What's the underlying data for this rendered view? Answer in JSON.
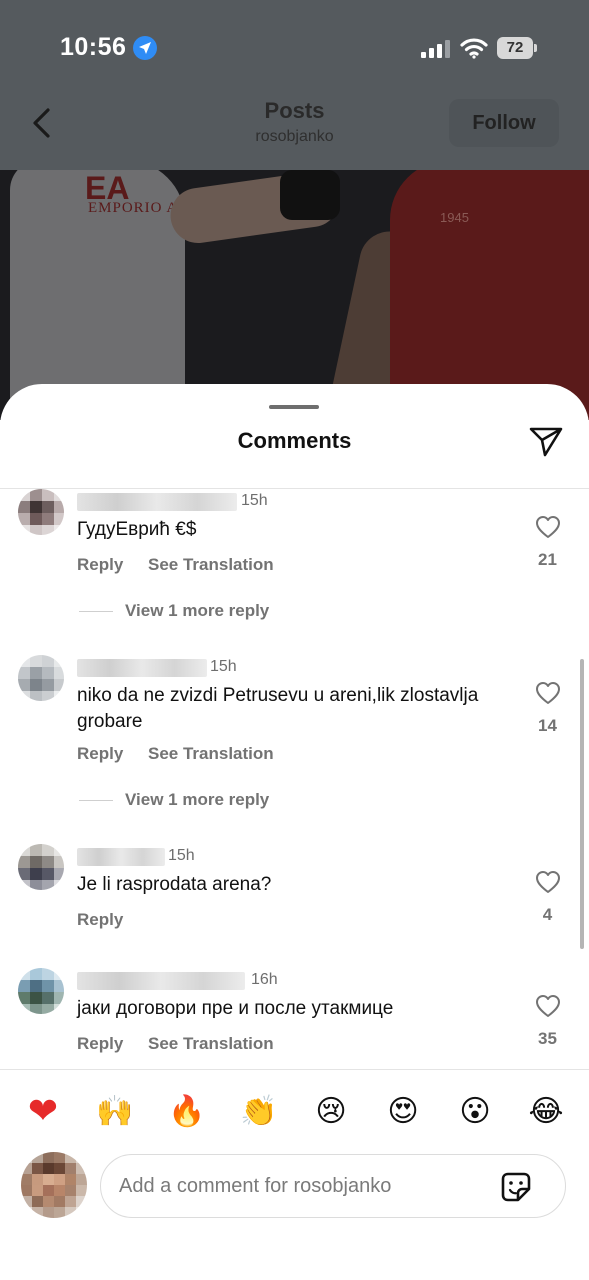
{
  "status_bar": {
    "time": "10:56",
    "battery": "72",
    "icons": [
      "location-arrow-icon",
      "signal-bars-icon",
      "wifi-icon",
      "battery-icon"
    ]
  },
  "header": {
    "title": "Posts",
    "subtitle": "rosobjanko",
    "follow_label": "Follow"
  },
  "comments_sheet": {
    "title": "Comments",
    "comments": [
      {
        "time": "15h",
        "text": "ГудуЕврић €$",
        "reply_label": "Reply",
        "translate_label": "See Translation",
        "likes": "21",
        "more_replies": "View 1 more reply"
      },
      {
        "time": "15h",
        "text": "niko da ne zvizdi Petrusevu u areni,lik zlostavlja grobare",
        "reply_label": "Reply",
        "translate_label": "See Translation",
        "likes": "14",
        "more_replies": "View 1 more reply"
      },
      {
        "time": "15h",
        "text": "Je li rasprodata arena?",
        "reply_label": "Reply",
        "likes": "4"
      },
      {
        "time": "16h",
        "text": "јаки договори пре и после утакмице",
        "reply_label": "Reply",
        "translate_label": "See Translation",
        "likes": "35"
      }
    ]
  },
  "emoji_bar": [
    "❤",
    "🙌",
    "🔥",
    "👏",
    "😢",
    "😍",
    "😮",
    "😂"
  ],
  "comment_input": {
    "placeholder": "Add a comment for rosobjanko"
  },
  "colors": {
    "accent_blue": "#2f8cf5",
    "muted_text": "#737373",
    "heart_red": "#e62a2a"
  }
}
